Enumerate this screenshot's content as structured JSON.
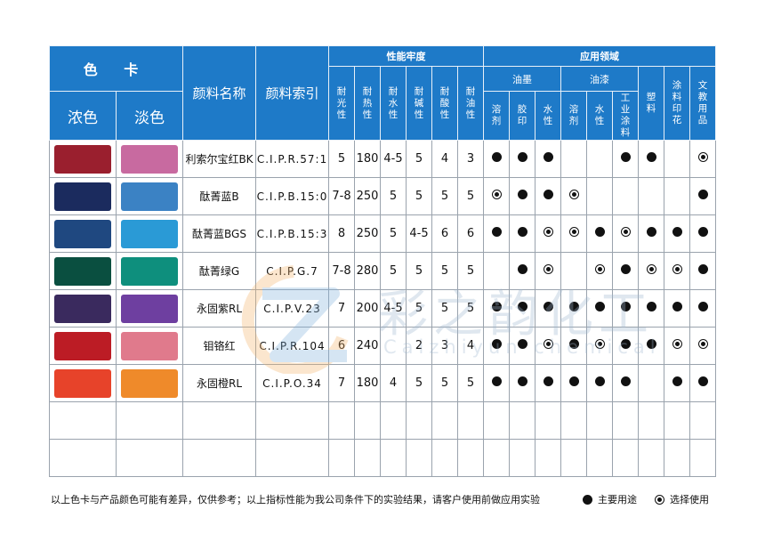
{
  "header": {
    "color_card": "色 卡",
    "dark": "浓色",
    "light": "淡色",
    "pigment_name": "颜料名称",
    "pigment_index": "颜料索引",
    "fastness": "性能牢度",
    "application": "应用领域",
    "fastness_cols": [
      "耐光性",
      "耐热性",
      "耐水性",
      "耐碱性",
      "耐酸性",
      "耐油性"
    ],
    "ink": "油墨",
    "paint": "油漆",
    "ink_cols": [
      "溶剂",
      "胶印",
      "水性"
    ],
    "paint_cols": [
      "溶剂",
      "水性",
      "工业涂料"
    ],
    "other_cols": [
      "塑料",
      "涂料印花",
      "文教用品"
    ]
  },
  "rows": [
    {
      "dark": "#9a1f2e",
      "light": "#c86aa0",
      "name": "利索尔宝红BK",
      "index": "C.I.P.R.57:1",
      "f": [
        "5",
        "180",
        "4-5",
        "5",
        "4",
        "3"
      ],
      "app": [
        "dot",
        "dot",
        "dot",
        "",
        "",
        "dot",
        "dot",
        "",
        "ring"
      ]
    },
    {
      "dark": "#1b2b5e",
      "light": "#3b82c4",
      "name": "酞菁蓝B",
      "index": "C.I.P.B.15:0",
      "f": [
        "7-8",
        "250",
        "5",
        "5",
        "5",
        "5"
      ],
      "app": [
        "ring",
        "dot",
        "dot",
        "ring",
        "",
        "",
        "",
        "",
        "dot"
      ]
    },
    {
      "dark": "#1f4880",
      "light": "#2a9ad6",
      "name": "酞菁蓝BGS",
      "index": "C.I.P.B.15:3",
      "f": [
        "8",
        "250",
        "5",
        "4-5",
        "6",
        "6"
      ],
      "app": [
        "dot",
        "dot",
        "ring",
        "ring",
        "dot",
        "ring",
        "dot",
        "dot",
        "dot"
      ]
    },
    {
      "dark": "#0a4f40",
      "light": "#0e8f7d",
      "name": "酞菁绿G",
      "index": "C.I.P.G.7",
      "f": [
        "7-8",
        "280",
        "5",
        "5",
        "5",
        "5"
      ],
      "app": [
        "",
        "dot",
        "ring",
        "",
        "ring",
        "dot",
        "ring",
        "ring",
        "dot"
      ]
    },
    {
      "dark": "#3a2a5e",
      "light": "#6e3fa0",
      "name": "永固紫RL",
      "index": "C.I.P.V.23",
      "f": [
        "7",
        "200",
        "4-5",
        "5",
        "5",
        "5"
      ],
      "app": [
        "dot",
        "dot",
        "dot",
        "dot",
        "dot",
        "dot",
        "dot",
        "dot",
        "dot"
      ]
    },
    {
      "dark": "#bc1c25",
      "light": "#e07a8c",
      "name": "钼铬红",
      "index": "C.I.P.R.104",
      "f": [
        "6",
        "240",
        "",
        "2",
        "3",
        "4"
      ],
      "app": [
        "dot",
        "dot",
        "ring",
        "dot",
        "ring",
        "dot",
        "dot",
        "ring",
        "ring"
      ]
    },
    {
      "dark": "#e7432a",
      "light": "#ef8a2a",
      "name": "永固橙RL",
      "index": "C.I.P.O.34",
      "f": [
        "7",
        "180",
        "4",
        "5",
        "5",
        "5"
      ],
      "app": [
        "dot",
        "dot",
        "dot",
        "dot",
        "dot",
        "dot",
        "",
        "dot",
        "dot"
      ]
    }
  ],
  "empty_rows": 2,
  "note": "以上色卡与产品颜色可能有差异，仅供参考；以上指标性能为我公司条件下的实验结果，请客户使用前做应用实验",
  "legend": {
    "main": "主要用途",
    "optional": "选择使用"
  },
  "watermark": {
    "cn": "彩之韵化工",
    "en": "Caizhiyun chemical"
  }
}
